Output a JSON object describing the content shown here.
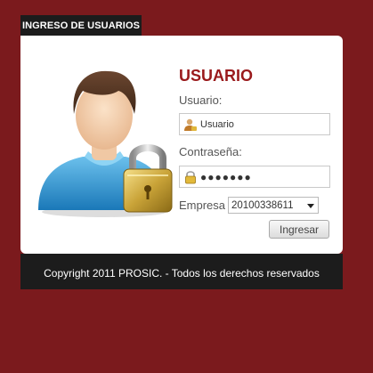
{
  "tab": {
    "label": "INGRESO DE USUARIOS"
  },
  "form": {
    "title": "USUARIO",
    "usuario_label": "Usuario:",
    "usuario_value": "Usuario",
    "password_label": "Contraseña:",
    "password_value": "●●●●●●●",
    "empresa_label": "Empresa",
    "empresa_value": "20100338611",
    "submit_label": "Ingresar"
  },
  "footer": {
    "text": "Copyright 2011 PROSIC. - Todos los derechos reservados"
  },
  "icons": {
    "avatar": "user-avatar-with-padlock",
    "user_field": "user-icon",
    "password_field": "lock-icon",
    "select_arrow": "chevron-down-icon"
  },
  "colors": {
    "background": "#7b1a1d",
    "title": "#9a1a1c",
    "bars": "#1c1c1c"
  }
}
